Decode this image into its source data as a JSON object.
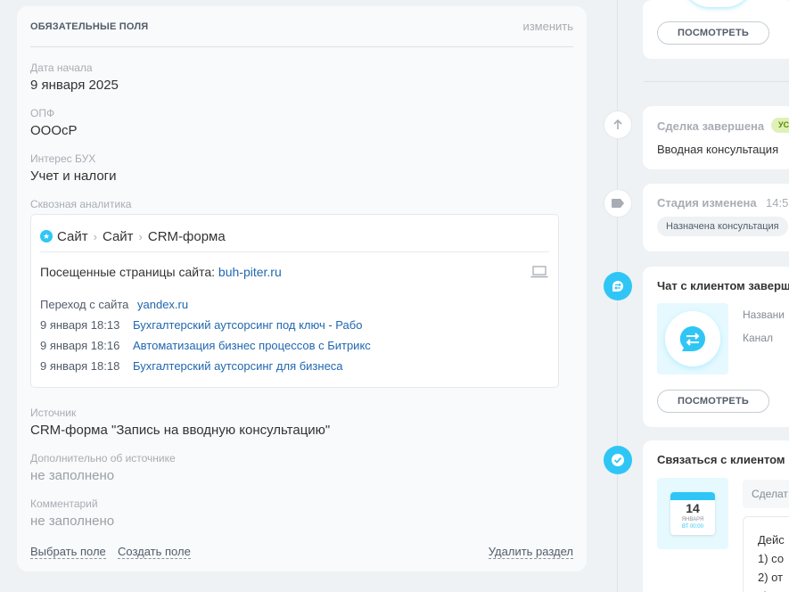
{
  "fields_panel": {
    "title": "ОБЯЗАТЕЛЬНЫЕ ПОЛЯ",
    "edit_label": "изменить",
    "fields": [
      {
        "label": "Дата начала",
        "value": "9 января 2025"
      },
      {
        "label": "ОПФ",
        "value": "ОООсР"
      },
      {
        "label": "Интерес БУХ",
        "value": "Учет и налоги"
      }
    ],
    "analytics": {
      "label": "Сквозная аналитика",
      "crumbs": [
        "Сайт",
        "Сайт",
        "CRM-форма"
      ],
      "visited_label": "Посещенные страницы сайта:",
      "visited_site": "buh-piter.ru",
      "from_label": "Переход с сайта",
      "from_site": "yandex.ru",
      "visits": [
        {
          "time": "9 января 18:13",
          "title": "Бухгалтерский аутсорсинг под ключ - Рабо"
        },
        {
          "time": "9 января 18:16",
          "title": "Автоматизация бизнес процессов с Битрикс"
        },
        {
          "time": "9 января 18:18",
          "title": "Бухгалтерский аутсорсинг для бизнеса"
        }
      ]
    },
    "source": {
      "label": "Источник",
      "value": "CRM-форма \"Запись на вводную консультацию\""
    },
    "source_extra": {
      "label": "Дополнительно об источнике",
      "value": "не заполнено"
    },
    "comment": {
      "label": "Комментарий",
      "value": "не заполнено"
    },
    "footer": {
      "select_field": "Выбрать поле",
      "create_field": "Создать поле",
      "delete_section": "Удалить раздел"
    }
  },
  "timeline": {
    "top_card": {
      "view_button": "ПОСМОТРЕТЬ"
    },
    "deal_done": {
      "title": "Сделка завершена",
      "badge": "УС",
      "text": "Вводная консультация"
    },
    "stage_changed": {
      "title": "Стадия изменена",
      "time": "14:5",
      "chip": "Назначена консультация"
    },
    "chat": {
      "title": "Чат с клиентом заверш",
      "name_label": "Названи",
      "channel_label": "Канал",
      "view_button": "ПОСМОТРЕТЬ"
    },
    "contact": {
      "title": "Связаться с клиентом",
      "calendar_day": "14",
      "calendar_month": "ЯНВАРЯ",
      "calendar_time": "ВТ 00:00",
      "todo_chip": "Сделат",
      "todo_lines": [
        "Дейс",
        "1) со",
        "2) от",
        "3)"
      ]
    }
  },
  "colors": {
    "accent": "#2fc6f6",
    "link": "#2067b0",
    "badge_green": "#dff1b8"
  }
}
